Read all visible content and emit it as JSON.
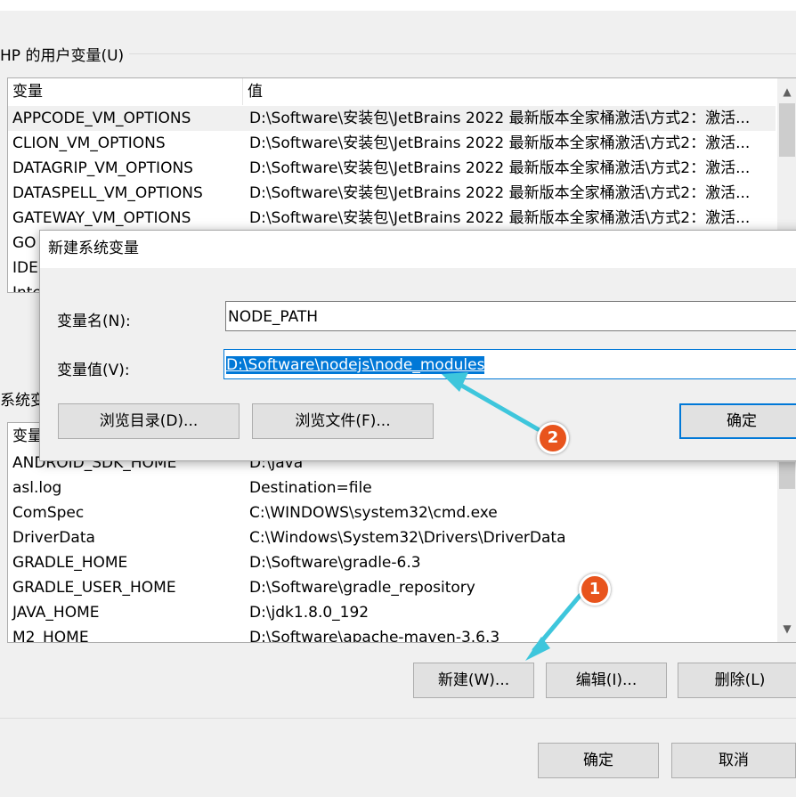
{
  "user_vars": {
    "group_label": "HP 的用户变量(U)",
    "col_name": "变量",
    "col_value": "值",
    "rows": [
      {
        "name": "APPCODE_VM_OPTIONS",
        "value": "D:\\Software\\安装包\\JetBrains 2022 最新版本全家桶激活\\方式2：激活..."
      },
      {
        "name": "CLION_VM_OPTIONS",
        "value": "D:\\Software\\安装包\\JetBrains 2022 最新版本全家桶激活\\方式2：激活..."
      },
      {
        "name": "DATAGRIP_VM_OPTIONS",
        "value": "D:\\Software\\安装包\\JetBrains 2022 最新版本全家桶激活\\方式2：激活..."
      },
      {
        "name": "DATASPELL_VM_OPTIONS",
        "value": "D:\\Software\\安装包\\JetBrains 2022 最新版本全家桶激活\\方式2：激活..."
      },
      {
        "name": "GATEWAY_VM_OPTIONS",
        "value": "D:\\Software\\安装包\\JetBrains 2022 最新版本全家桶激活\\方式2：激活..."
      },
      {
        "name": "GO",
        "value": ""
      },
      {
        "name": "IDE",
        "value": ""
      },
      {
        "name": "Inte",
        "value": ""
      }
    ]
  },
  "system_vars": {
    "group_label": "系统变",
    "col_name": "变量",
    "rows": [
      {
        "name": "ANDROID_SDK_HOME",
        "value": "D:\\java"
      },
      {
        "name": "asl.log",
        "value": "Destination=file"
      },
      {
        "name": "ComSpec",
        "value": "C:\\WINDOWS\\system32\\cmd.exe"
      },
      {
        "name": "DriverData",
        "value": "C:\\Windows\\System32\\Drivers\\DriverData"
      },
      {
        "name": "GRADLE_HOME",
        "value": "D:\\Software\\gradle-6.3"
      },
      {
        "name": "GRADLE_USER_HOME",
        "value": "D:\\Software\\gradle_repository"
      },
      {
        "name": "JAVA_HOME",
        "value": "D:\\jdk1.8.0_192"
      },
      {
        "name": "M2_HOME",
        "value": "D:\\Software\\apache-maven-3.6.3"
      }
    ],
    "buttons": {
      "new": "新建(W)...",
      "edit": "编辑(I)...",
      "delete": "删除(L)"
    }
  },
  "footer": {
    "ok": "确定",
    "cancel": "取消"
  },
  "dialog": {
    "title": "新建系统变量",
    "name_label": "变量名(N):",
    "name_value": "NODE_PATH",
    "value_label": "变量值(V):",
    "value_value": "D:\\Software\\nodejs\\node_modules",
    "browse_dir": "浏览目录(D)...",
    "browse_file": "浏览文件(F)...",
    "ok": "确定"
  },
  "annotations": {
    "badge1": "1",
    "badge2": "2",
    "arrow_color": "#3ec6dc",
    "badge_color": "#e8541d"
  },
  "icons": [
    "chevron-up-icon",
    "chevron-down-icon"
  ]
}
